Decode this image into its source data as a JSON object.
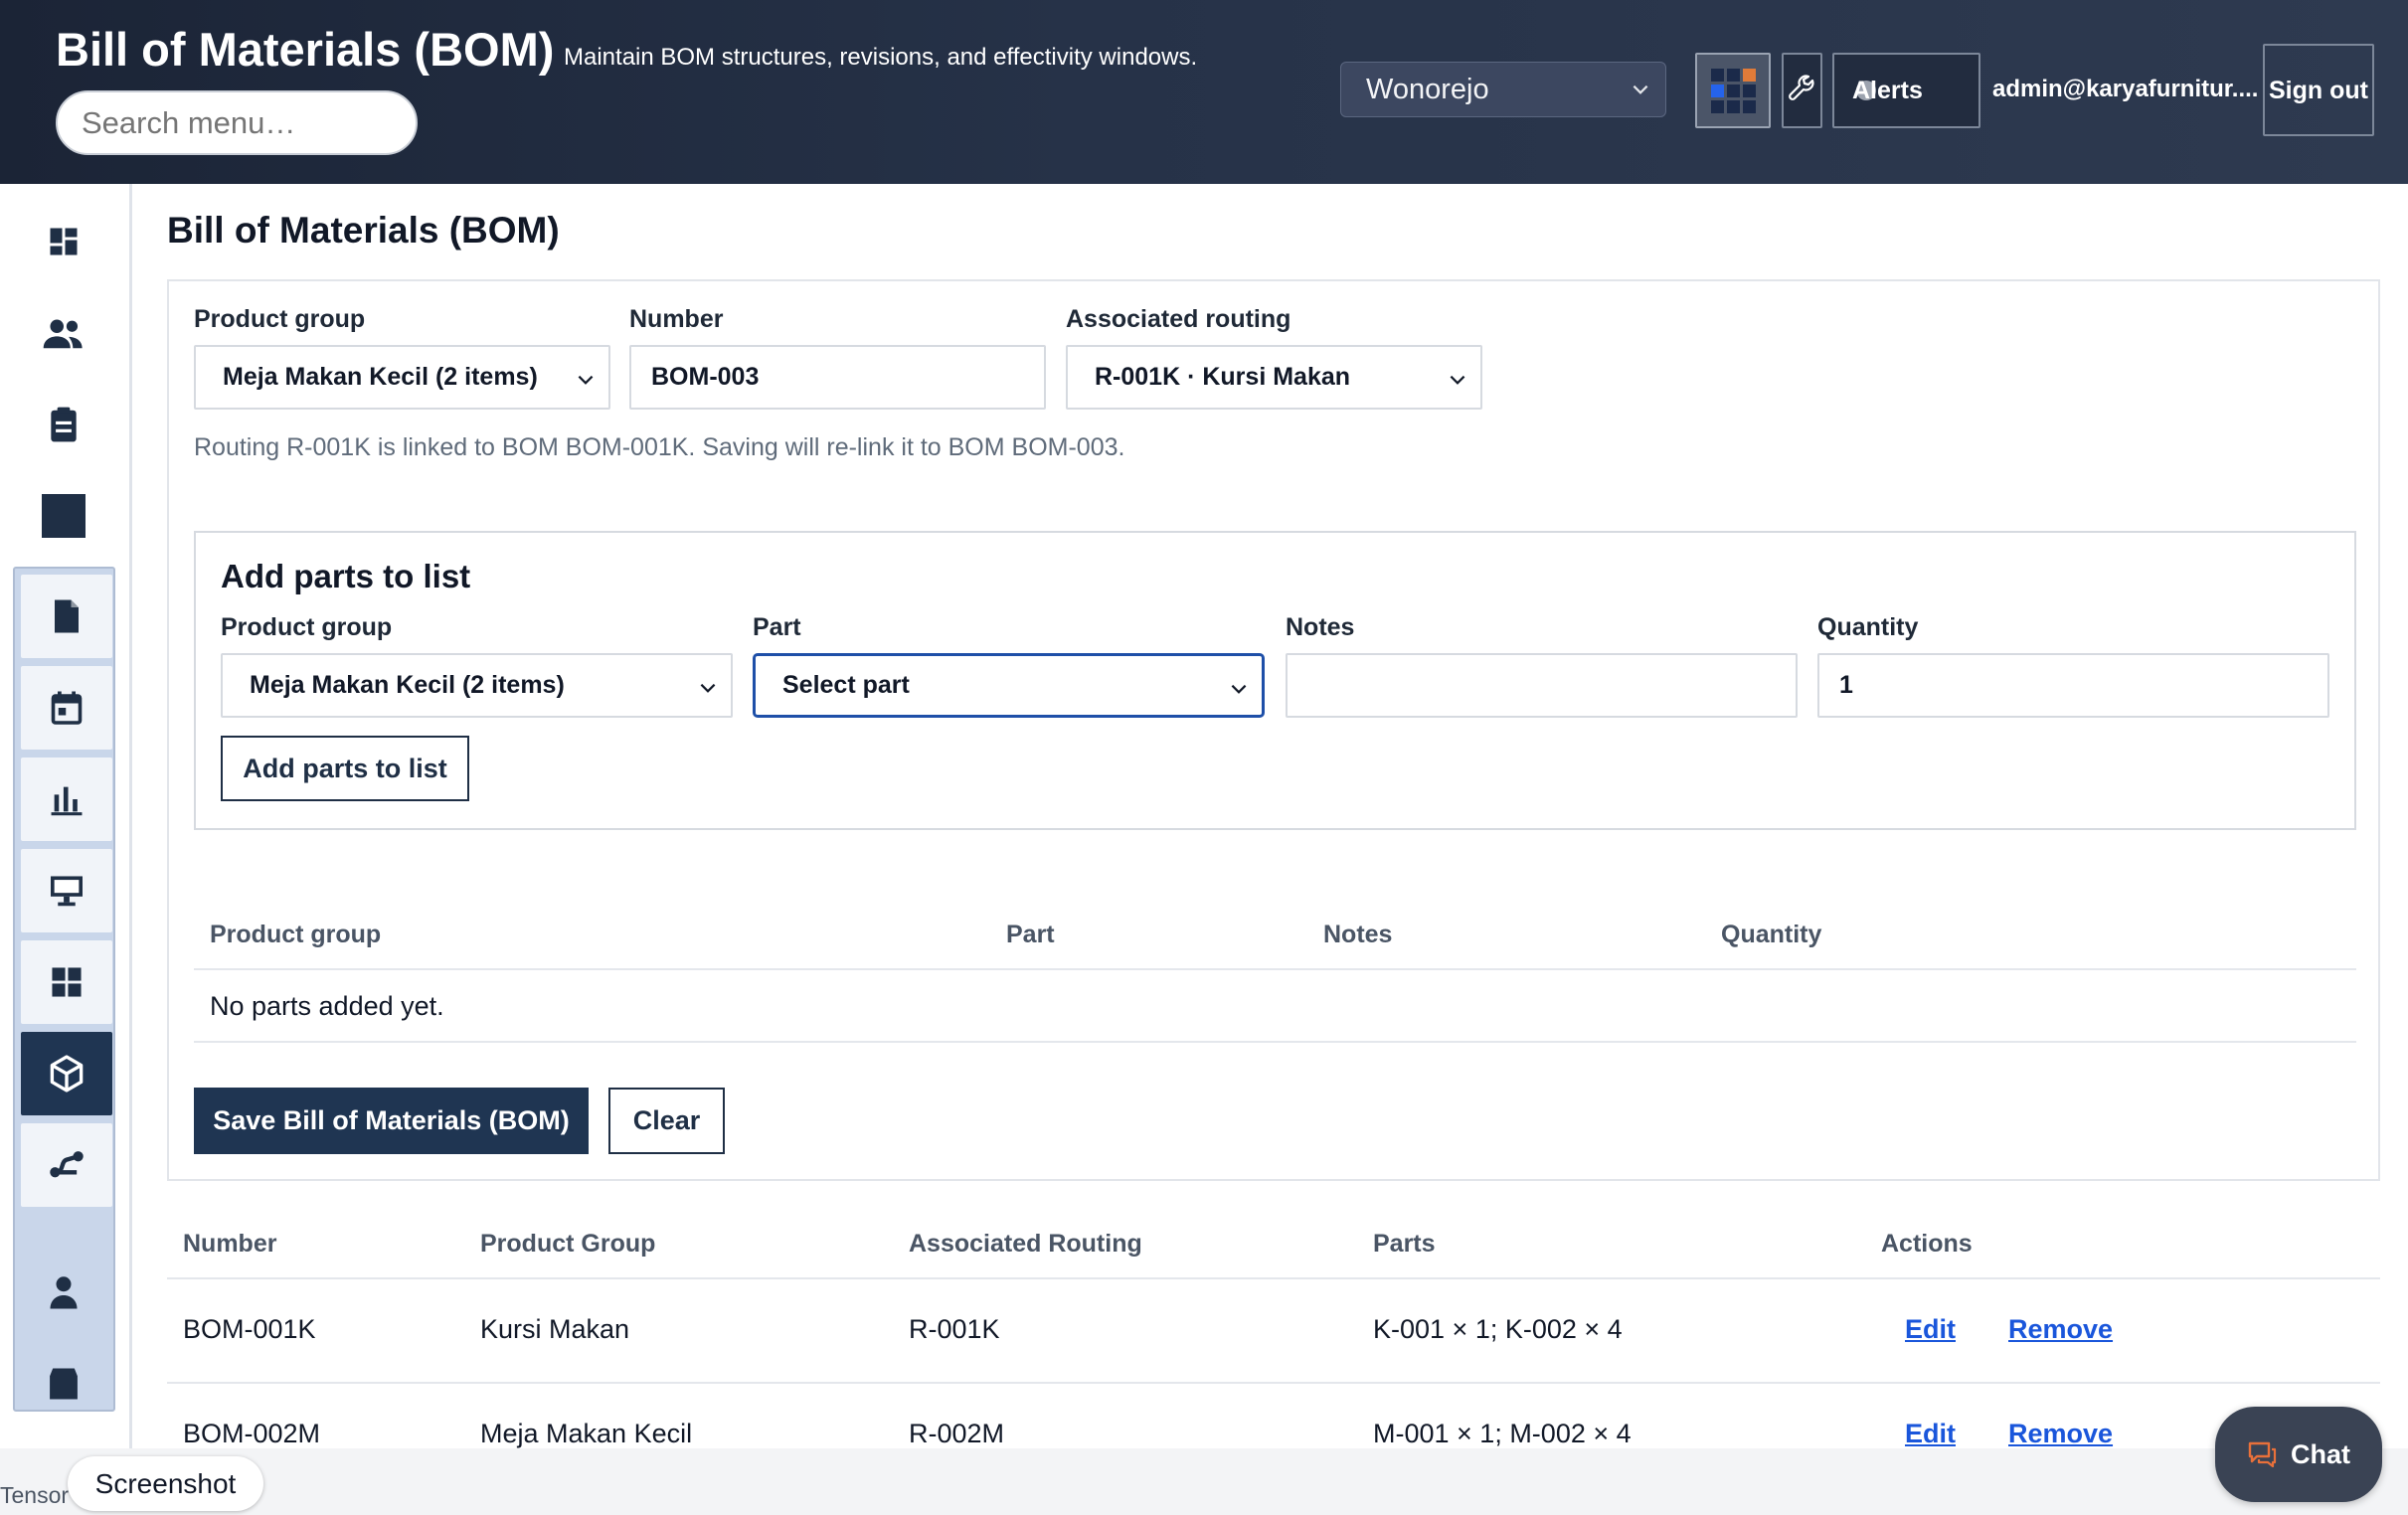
{
  "header": {
    "title": "Bill of Materials (BOM)",
    "subtitle": "Maintain BOM structures, revisions, and effectivity windows.",
    "search_placeholder": "Search menu…",
    "site": "Wonorejo",
    "alerts_label": "Alerts",
    "user_email": "admin@karyafurnitur....",
    "signout_label": "Sign out"
  },
  "sidebar": {
    "icons": [
      "dashboard-icon",
      "users-icon",
      "clipboard-icon",
      "square-icon",
      "document-icon",
      "calendar-icon",
      "bar-chart-icon",
      "monitor-icon",
      "grid-icon",
      "cube-icon",
      "route-icon",
      "person-icon",
      "box-icon"
    ],
    "active": "cube-icon"
  },
  "page": {
    "title": "Bill of Materials (BOM)"
  },
  "form": {
    "product_group_label": "Product group",
    "product_group_value": "Meja Makan Kecil (2 items)",
    "number_label": "Number",
    "number_value": "BOM-003",
    "routing_label": "Associated routing",
    "routing_value": "R-001K · Kursi Makan",
    "hint": "Routing R-001K is linked to BOM BOM-001K. Saving will re-link it to BOM BOM-003."
  },
  "add_parts": {
    "title": "Add parts to list",
    "product_group_label": "Product group",
    "product_group_value": "Meja Makan Kecil (2 items)",
    "part_label": "Part",
    "part_value": "Select part",
    "notes_label": "Notes",
    "notes_value": "",
    "quantity_label": "Quantity",
    "quantity_value": "1",
    "button_label": "Add parts to list"
  },
  "parts_table": {
    "headers": [
      "Product group",
      "Part",
      "Notes",
      "Quantity"
    ],
    "empty_text": "No parts added yet."
  },
  "actions": {
    "save_label": "Save Bill of Materials (BOM)",
    "clear_label": "Clear"
  },
  "bom_table": {
    "headers": [
      "Number",
      "Product Group",
      "Associated Routing",
      "Parts",
      "Actions"
    ],
    "rows": [
      {
        "number": "BOM-001K",
        "product_group": "Kursi Makan",
        "routing": "R-001K",
        "parts": "K-001 × 1; K-002 × 4",
        "edit": "Edit",
        "remove": "Remove"
      },
      {
        "number": "BOM-002M",
        "product_group": "Meja Makan Kecil",
        "routing": "R-002M",
        "parts": "M-001 × 1; M-002 × 4",
        "edit": "Edit",
        "remove": "Remove"
      }
    ]
  },
  "footer": {
    "tensor_text": "Tensor",
    "screenshot_label": "Screenshot",
    "chat_label": "Chat"
  }
}
